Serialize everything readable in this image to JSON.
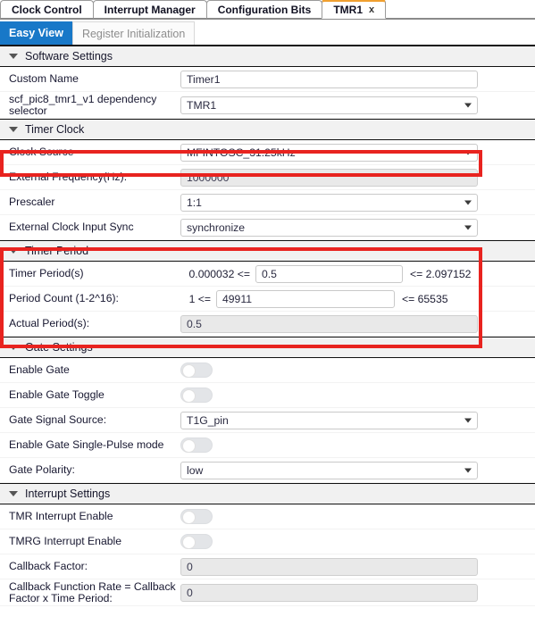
{
  "window": {
    "tabs": [
      {
        "label": "Clock Control",
        "active": false,
        "closable": false
      },
      {
        "label": "Interrupt Manager",
        "active": false,
        "closable": false
      },
      {
        "label": "Configuration Bits",
        "active": false,
        "closable": false
      },
      {
        "label": "TMR1",
        "active": true,
        "closable": true,
        "close_glyph": "x"
      }
    ],
    "subtabs": [
      {
        "label": "Easy View",
        "selected": true
      },
      {
        "label": "Register Initialization",
        "selected": false
      }
    ]
  },
  "sections": {
    "software_settings": {
      "title": "Software Settings",
      "caret": "chevron-down-icon",
      "rows": [
        {
          "label": "Custom Name",
          "value": "Timer1",
          "kind": "text"
        },
        {
          "label": "scf_pic8_tmr1_v1 dependency selector",
          "value": "TMR1",
          "kind": "select"
        }
      ]
    },
    "timer_clock": {
      "title": "Timer Clock",
      "caret": "chevron-down-icon",
      "rows": [
        {
          "label": "Clock Source",
          "value": "MFINTOSC_31.25kHz",
          "kind": "select",
          "highlighted": true
        },
        {
          "label": "External Frequency(Hz):",
          "value": "1000000",
          "kind": "text-disabled"
        },
        {
          "label": "Prescaler",
          "value": "1:1",
          "kind": "select"
        },
        {
          "label": "External Clock Input Sync",
          "value": "synchronize",
          "kind": "select"
        }
      ]
    },
    "timer_period": {
      "title": "Timer Period",
      "caret": "chevron-down-icon",
      "highlighted": true,
      "rows": [
        {
          "label": "Timer Period(s)",
          "min": "0.000032 <=",
          "value": "0.5",
          "max": "<= 2.097152",
          "kind": "range"
        },
        {
          "label": "Period Count (1-2^16):",
          "min": "1 <=",
          "value": "49911",
          "max": "<= 65535",
          "kind": "range"
        },
        {
          "label": "Actual Period(s):",
          "value": "0.5",
          "kind": "text-disabled"
        }
      ]
    },
    "gate_settings": {
      "title": "Gate Settings",
      "caret": "chevron-down-icon",
      "rows": [
        {
          "label": "Enable Gate",
          "kind": "toggle",
          "on": false
        },
        {
          "label": "Enable Gate Toggle",
          "kind": "toggle",
          "on": false
        },
        {
          "label": "Gate Signal Source:",
          "value": "T1G_pin",
          "kind": "select"
        },
        {
          "label": "Enable Gate Single-Pulse mode",
          "kind": "toggle",
          "on": false
        },
        {
          "label": "Gate Polarity:",
          "value": "low",
          "kind": "select"
        }
      ]
    },
    "interrupt_settings": {
      "title": "Interrupt Settings",
      "caret": "chevron-down-icon",
      "rows": [
        {
          "label": "TMR Interrupt Enable",
          "kind": "toggle",
          "on": false
        },
        {
          "label": "TMRG Interrupt Enable",
          "kind": "toggle",
          "on": false
        },
        {
          "label": "Callback Factor:",
          "value": "0",
          "kind": "text-disabled"
        },
        {
          "label": "Callback Function Rate = Callback Factor x Time Period:",
          "value": "0",
          "kind": "text-disabled"
        }
      ]
    }
  },
  "colors": {
    "highlight_red": "#e8231f",
    "active_tab_accent": "#f0a030",
    "selected_subtab": "#1878c8",
    "section_header_bg": "#f1f1f1"
  }
}
